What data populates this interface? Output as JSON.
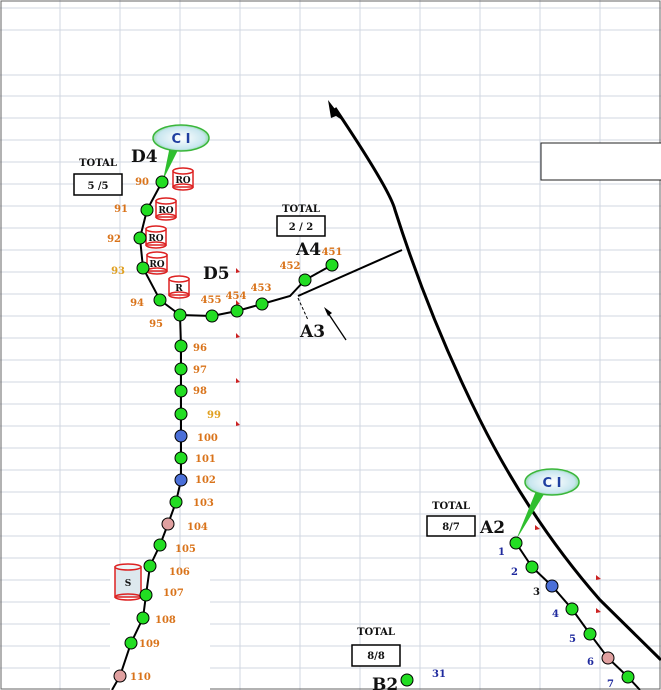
{
  "labels": {
    "D4": "D4",
    "D5": "D5",
    "A4": "A4",
    "A3": "A3",
    "A2": "A2",
    "B2": "B2"
  },
  "totals": [
    {
      "caption": "TOTAL",
      "value": "5 /5"
    },
    {
      "caption": "TOTAL",
      "value": "2 / 2"
    },
    {
      "caption": "TOTAL",
      "value": "8/7"
    },
    {
      "caption": "TOTAL",
      "value": "8/8"
    }
  ],
  "callouts": [
    "C I",
    "C I"
  ],
  "equipment": [
    "RO",
    "RO",
    "RO",
    "RO",
    "R",
    "S"
  ],
  "d4_nodes": [
    "90",
    "91",
    "92",
    "93",
    "94",
    "95"
  ],
  "d5_nodes": [
    "455",
    "454",
    "453",
    "452",
    "451"
  ],
  "trunk_nodes": [
    "96",
    "97",
    "98",
    "99",
    "100",
    "101",
    "102",
    "103",
    "104",
    "105",
    "106",
    "107",
    "108",
    "109",
    "110"
  ],
  "a2_nodes": [
    "1",
    "2",
    "3",
    "4",
    "5",
    "6",
    "7"
  ],
  "b2_nodes": [
    "31"
  ],
  "colors": {
    "node_green": "#22dd22",
    "node_blue": "#4a6fd8",
    "node_pink": "#e0a0a0",
    "label_orange": "#d9731a",
    "label_blue": "#1f2a9e",
    "grid": "#d0d7e2"
  }
}
